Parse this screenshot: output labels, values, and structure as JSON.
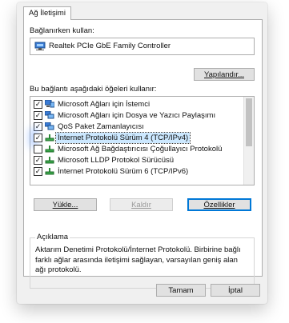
{
  "tab": {
    "label": "Ağ İletişimi"
  },
  "connect_using": {
    "label": "Bağlanırken kullan:",
    "adapter_name": "Realtek PCIe GbE Family Controller",
    "configure_button": "Yapılandır..."
  },
  "items_section": {
    "label": "Bu bağlantı aşağıdaki öğeleri kullanır:",
    "items": [
      {
        "label": "Microsoft Ağları için İstemci",
        "checked": true,
        "icon": "network-client-icon"
      },
      {
        "label": "Microsoft Ağları için Dosya ve Yazıcı Paylaşımı",
        "checked": true,
        "icon": "network-service-icon"
      },
      {
        "label": "QoS Paket Zamanlayıcısı",
        "checked": true,
        "icon": "network-service-icon"
      },
      {
        "label": "İnternet Protokolü Sürüm 4 (TCP/IPv4)",
        "checked": true,
        "icon": "protocol-icon",
        "selected": true
      },
      {
        "label": "Microsoft Ağ Bağdaştırıcısı Çoğullayıcı Protokolü",
        "checked": false,
        "icon": "protocol-icon"
      },
      {
        "label": "Microsoft LLDP Protokol Sürücüsü",
        "checked": true,
        "icon": "protocol-icon"
      },
      {
        "label": "İnternet Protokolü Sürüm 6 (TCP/IPv6)",
        "checked": true,
        "icon": "protocol-icon"
      }
    ]
  },
  "buttons": {
    "install": "Yükle...",
    "uninstall": "Kaldır",
    "properties": "Özellikler",
    "ok": "Tamam",
    "cancel": "İptal"
  },
  "description": {
    "title": "Açıklama",
    "text": "Aktarım Denetimi Protokolü/İnternet Protokolü. Birbirine bağlı farklı ağlar arasında iletişimi sağlayan, varsayılan geniş alan ağı protokolü."
  },
  "colors": {
    "selection": "#cce8ff",
    "focus_glow": "#78aaff",
    "dialog_bg": "#f0f0f0"
  }
}
